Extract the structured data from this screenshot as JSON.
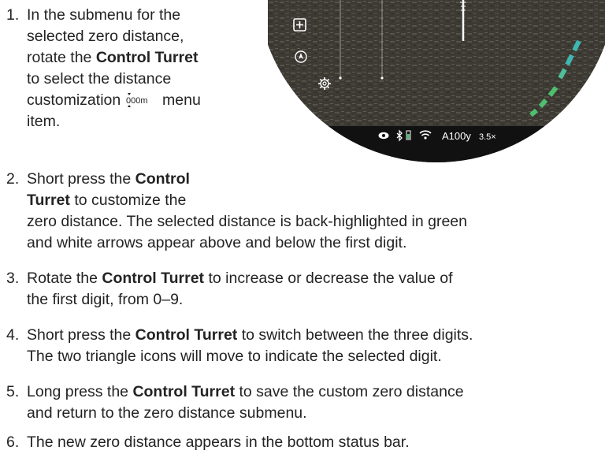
{
  "steps": [
    {
      "number": "1.",
      "lines": [
        "In the submenu for the",
        "selected zero distance,",
        "rotate the ",
        "to select the distance",
        "customization ",
        "item."
      ],
      "bold": "Control Turret",
      "icon_label": "000m",
      "after_icon": " menu"
    },
    {
      "number": "2.",
      "pre": "Short press the ",
      "bold": "Control",
      "line2_bold": "Turret",
      "line2_rest": " to customize the",
      "line3": "zero distance. The selected distance is back-highlighted in green",
      "line4": "and white arrows appear above and below the first digit."
    },
    {
      "number": "3.",
      "pre": "Rotate the ",
      "bold": "Control Turret",
      "post": " to increase or decrease the value of",
      "line2": "the first digit, from 0–9."
    },
    {
      "number": "4.",
      "pre": "Short press the ",
      "bold": "Control Turret",
      "post": " to switch between the three digits.",
      "line2": "The two triangle icons will move to indicate the selected digit."
    },
    {
      "number": "5.",
      "pre": "Long press the ",
      "bold": "Control Turret",
      "post": " to save the custom zero distance",
      "line2": "and return to the zero distance submenu."
    },
    {
      "number": "6.",
      "line1": "The new zero distance appears in the bottom status bar."
    }
  ],
  "scope_status": {
    "zero": "A100y",
    "zoom": "3.5×"
  },
  "icon_names": [
    "plus-box-icon",
    "compass-icon",
    "gear-icon",
    "eye-icon",
    "bluetooth-icon",
    "battery-icon",
    "wifi-icon"
  ],
  "colors": {
    "text": "#232323",
    "scope_bg": "#3a372f",
    "status_bar": "#111111",
    "arc_green": "#4fbf6f",
    "arc_teal": "#3fb7b0"
  }
}
